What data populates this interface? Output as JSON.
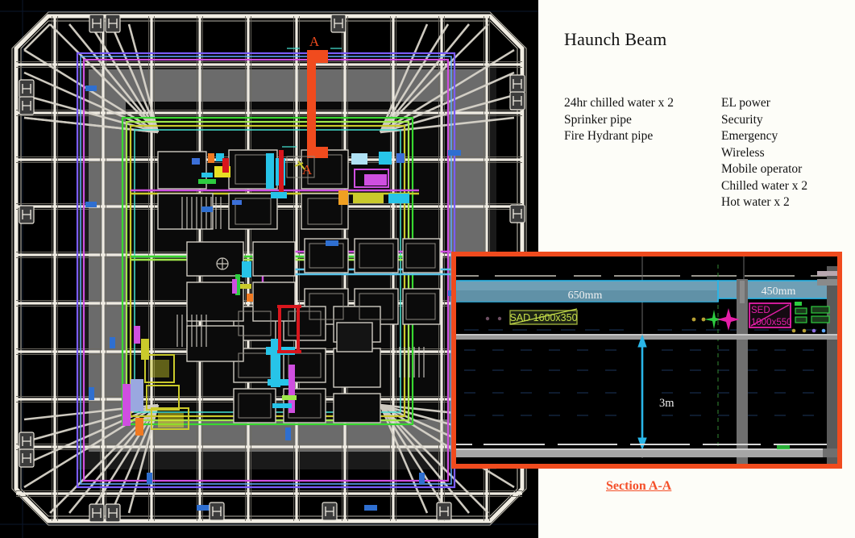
{
  "notes": {
    "title": "Haunch Beam",
    "left_column": [
      "24hr chilled water x 2",
      "Sprinker pipe",
      "Fire Hydrant pipe"
    ],
    "right_column": [
      "EL power",
      "Security",
      "Emergency",
      "Wireless",
      "Mobile operator",
      "Chilled water x 2",
      "Hot water x 2"
    ]
  },
  "plan": {
    "section_marker_top": "A",
    "section_marker_bottom": "A",
    "section_marker_color": "#f04b1e",
    "background": "#000000",
    "grid_color": "#f0ece2",
    "slab_color": "#6e6e6e"
  },
  "section_detail": {
    "caption": "Section A-A",
    "caption_color": "#f4502a",
    "border_color": "#f04b1e",
    "background": "#000000",
    "beam_deep_label": "650mm",
    "beam_shallow_label": "450mm",
    "clear_height_label": "3m",
    "duct_label": "SAD 1600x350",
    "equipment_label_line1": "SED",
    "equipment_label_line2": "1000x550",
    "beam_fill": "#5b92ad",
    "beam_outline": "#29b6e8",
    "dimension_color": "#29b6e8",
    "duct_label_color": "#c8e04a",
    "equipment_label_color": "#e51ea8"
  }
}
